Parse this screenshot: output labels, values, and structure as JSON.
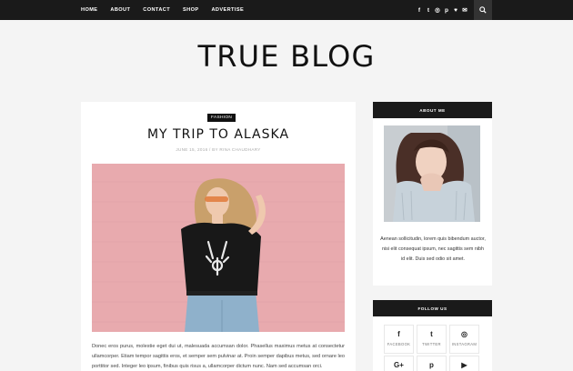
{
  "nav": {
    "items": [
      "HOME",
      "ABOUT",
      "CONTACT",
      "SHOP",
      "ADVERTISE"
    ],
    "social_icons": [
      {
        "name": "facebook-icon",
        "glyph": "f"
      },
      {
        "name": "twitter-icon",
        "glyph": "t"
      },
      {
        "name": "instagram-icon",
        "glyph": "◎"
      },
      {
        "name": "pinterest-icon",
        "glyph": "p"
      },
      {
        "name": "heart-icon",
        "glyph": "♥"
      },
      {
        "name": "mail-icon",
        "glyph": "✉"
      }
    ],
    "search_icon": "search-icon"
  },
  "blog": {
    "title": "TRUE BLOG"
  },
  "post": {
    "category": "FASHION",
    "title": "MY TRIP TO ALASKA",
    "meta": "JUNE 15, 2016 / BY RINA CHAUDHARY",
    "excerpt": "Donec eros purus, molestie eget dui ut, malesuada accumsan dolor. Phasellus maximus metus at consectetur ullamcorper. Etiam tempor sagittis eros, et semper sem pulvinar at. Proin semper dapibus metus, sed ornare leo porttitor sed. Integer leo ipsum, finibus quis risus a, ullamcorper dictum nunc. Nam sed accumsan orci."
  },
  "sidebar": {
    "about": {
      "heading": "ABOUT ME",
      "text": "Aenean sollicitudin, lorem quis bibendum auctor, nisi elit consequat ipsum, nec sagittis sem nibh id elit. Duis sed odio sit amet."
    },
    "follow": {
      "heading": "FOLLOW US",
      "items": [
        {
          "label": "FACEBOOK",
          "icon": "facebook-icon",
          "glyph": "f"
        },
        {
          "label": "TWITTER",
          "icon": "twitter-icon",
          "glyph": "t"
        },
        {
          "label": "INSTAGRAM",
          "icon": "instagram-icon",
          "glyph": "◎"
        },
        {
          "label": "",
          "icon": "google-plus-icon",
          "glyph": "G+"
        },
        {
          "label": "",
          "icon": "pinterest-icon",
          "glyph": "p"
        },
        {
          "label": "",
          "icon": "youtube-icon",
          "glyph": "▶"
        }
      ]
    }
  },
  "colors": {
    "nav_bg": "#1a1a1a",
    "page_bg": "#f4f4f4",
    "card_bg": "#ffffff",
    "post_image_bg": "#e6a8ab"
  }
}
